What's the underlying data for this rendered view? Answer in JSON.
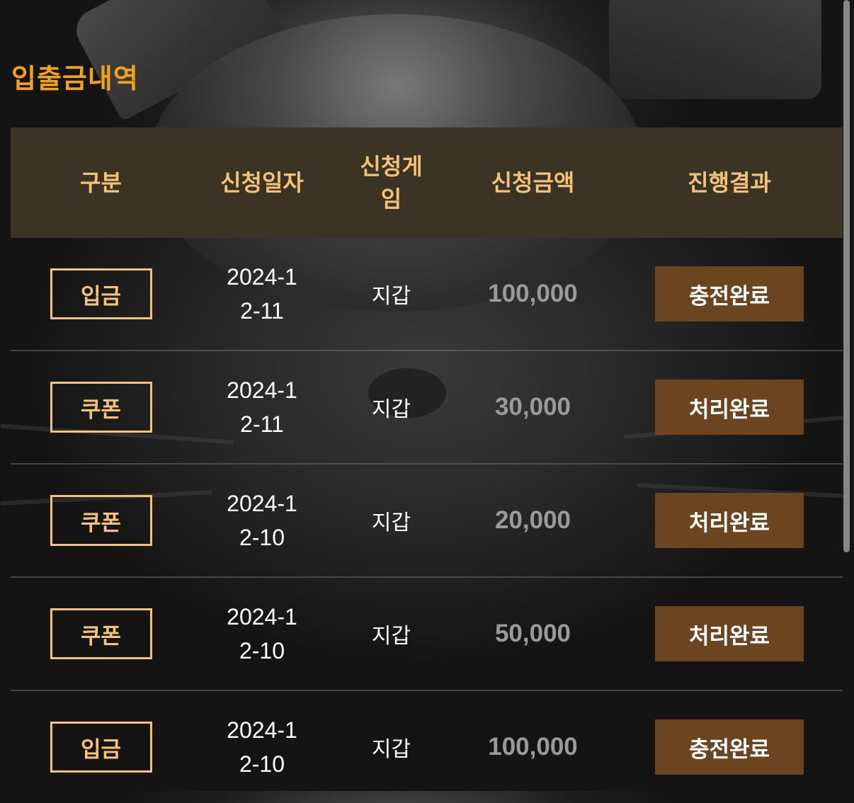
{
  "page": {
    "title": "입출금내역"
  },
  "colors": {
    "title": "#f2a31b",
    "header_bg": "#3b3323",
    "header_text": "#f5c27a",
    "badge_border": "#f5c27a",
    "status_bg": "#6a4520",
    "amount_text": "#9a9a9a"
  },
  "table": {
    "headers": {
      "type": "구분",
      "date": "신청일자",
      "game": "신청게임",
      "amount": "신청금액",
      "status": "진행결과"
    },
    "rows": [
      {
        "type": "입금",
        "date": "2024-12-11",
        "game": "지갑",
        "amount": "100,000",
        "status": "충전완료"
      },
      {
        "type": "쿠폰",
        "date": "2024-12-11",
        "game": "지갑",
        "amount": "30,000",
        "status": "처리완료"
      },
      {
        "type": "쿠폰",
        "date": "2024-12-10",
        "game": "지갑",
        "amount": "20,000",
        "status": "처리완료"
      },
      {
        "type": "쿠폰",
        "date": "2024-12-10",
        "game": "지갑",
        "amount": "50,000",
        "status": "처리완료"
      },
      {
        "type": "입금",
        "date": "2024-12-10",
        "game": "지갑",
        "amount": "100,000",
        "status": "충전완료"
      }
    ]
  }
}
